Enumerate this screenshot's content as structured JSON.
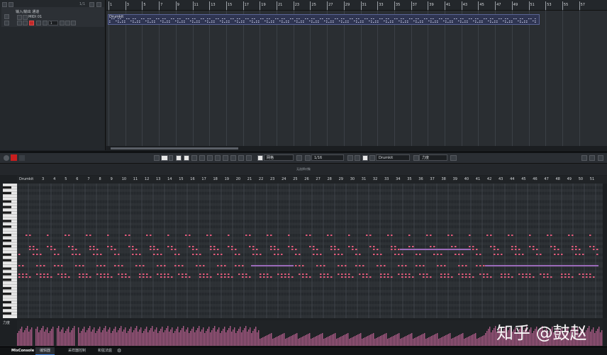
{
  "inspector": {
    "top_counter": "1/1",
    "track_folder_label": "输入/输出 通道",
    "track_name": "MIDI 01",
    "channel_value": "1"
  },
  "arrangement": {
    "ruler_bars": [
      "1",
      "3",
      "5",
      "7",
      "9",
      "11",
      "13",
      "15",
      "17",
      "19",
      "21",
      "23",
      "25",
      "27",
      "29",
      "31",
      "33",
      "35",
      "37",
      "39",
      "41",
      "43",
      "45",
      "47",
      "49",
      "51",
      "53",
      "55",
      "57"
    ],
    "part_name": "Drumkit"
  },
  "editor_toolbar": {
    "quantize_mode": "网格",
    "quantize_value": "1/16",
    "drum_map": "Drumkit",
    "velocity_lane": "力度"
  },
  "editor_info": {
    "label": "无选择对象"
  },
  "piano_roll": {
    "ruler_first": "Drumkit",
    "ruler_bars": [
      "3",
      "4",
      "5",
      "6",
      "7",
      "8",
      "9",
      "10",
      "11",
      "12",
      "13",
      "14",
      "15",
      "16",
      "17",
      "18",
      "19",
      "20",
      "21",
      "22",
      "23",
      "24",
      "25",
      "26",
      "27",
      "28",
      "29",
      "30",
      "31",
      "32",
      "33",
      "34",
      "35",
      "36",
      "37",
      "38",
      "39",
      "40",
      "41",
      "42",
      "43",
      "44",
      "45",
      "46",
      "47",
      "48",
      "49",
      "50",
      "51"
    ]
  },
  "velocity": {
    "label": "力度"
  },
  "bottom_tabs": {
    "tab1": "MixConsole",
    "tab2": "编辑器",
    "tab3": "采样器控制",
    "tab4": "和弦法庭"
  },
  "watermark": "知乎 @鼓赵",
  "colors": {
    "note": "#e05a7a",
    "note_long": "#9a6ab8",
    "velocity_bar": "#a85a84",
    "part_border": "#5a6495",
    "record": "#e02020"
  }
}
